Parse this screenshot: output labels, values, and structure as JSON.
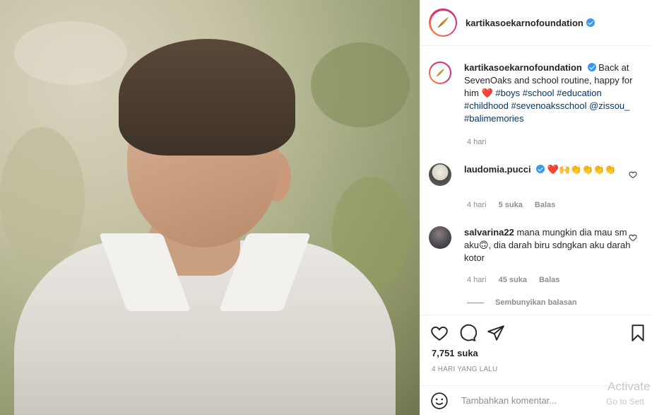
{
  "post": {
    "author": "kartikasoekarnofoundation",
    "caption_author": "kartikasoekarnofoundation",
    "caption_text_1": "Back at SevenOaks and school routine, happy for him",
    "caption_heart": "❤️",
    "tags": [
      "#boys",
      "#school",
      "#education",
      "#childhood",
      "#sevenoaksschool",
      "@zissou_",
      "#balimemories"
    ],
    "caption_age": "4 hari"
  },
  "comments": [
    {
      "username": "laudomia.pucci",
      "text": "❤️🙌👏👏👏👏",
      "age": "4 hari",
      "likes": "5 suka",
      "reply": "Balas"
    },
    {
      "username": "salvarina22",
      "text": "mana mungkin dia mau sm aku🙃, dia darah biru sdngkan aku darah kotor",
      "age": "4 hari",
      "likes": "45 suka",
      "reply": "Balas"
    }
  ],
  "hide_replies": "Sembunyikan balasan",
  "stats": {
    "likes": "7,751 suka",
    "date": "4 HARI YANG LALU"
  },
  "add_comment": {
    "placeholder": "Tambahkan komentar..."
  },
  "watermark": {
    "title": "Activate",
    "subtitle": "Go to Sett"
  },
  "icons": {
    "like": "heart-icon",
    "comment": "comment-icon",
    "share": "send-icon",
    "save": "bookmark-icon",
    "emoji": "emoji-icon",
    "verified": "verified-badge-icon"
  },
  "colors": {
    "accent": "#3897f0",
    "heart": "#ed4956",
    "link": "#00376b",
    "muted": "#8e8e8e"
  }
}
